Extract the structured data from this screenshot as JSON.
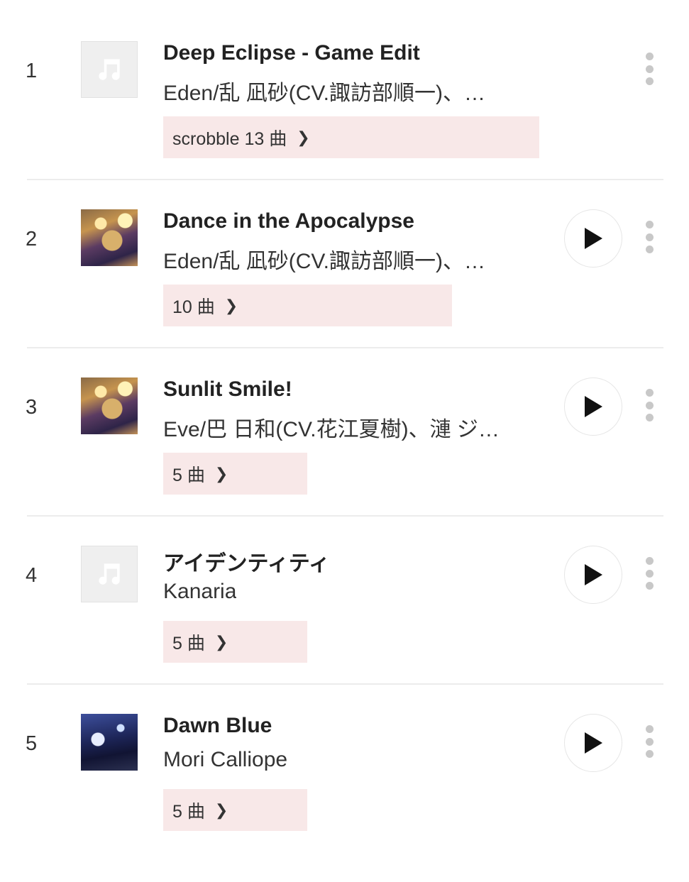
{
  "tracks": [
    {
      "rank": "1",
      "title": "Deep Eclipse - Game Edit",
      "artist": "Eden/乱 凪砂(CV.諏訪部順一)、…",
      "chip_label": "scrobble 13 曲",
      "artwork": "music-note-placeholder",
      "has_play": false
    },
    {
      "rank": "2",
      "title": "Dance in the Apocalypse",
      "artist": "Eden/乱 凪砂(CV.諏訪部順一)、…",
      "chip_label": "10 曲",
      "artwork": "album-art",
      "has_play": true
    },
    {
      "rank": "3",
      "title": "Sunlit Smile!",
      "artist": "Eve/巴 日和(CV.花江夏樹)、漣 ジ…",
      "chip_label": "5 曲",
      "artwork": "album-art",
      "has_play": true
    },
    {
      "rank": "4",
      "title": "アイデンティティ",
      "artist": "Kanaria",
      "chip_label": "5 曲",
      "artwork": "music-note-placeholder",
      "has_play": true
    },
    {
      "rank": "5",
      "title": "Dawn Blue",
      "artist": "Mori Calliope",
      "chip_label": "5 曲",
      "artwork": "album-art",
      "has_play": true
    }
  ],
  "icons": {
    "chevron": "chevron-right-icon",
    "play": "play-icon",
    "more": "more-vertical-icon",
    "placeholder": "music-note-icon"
  },
  "colors": {
    "chip_bg": "#f8e8e8",
    "divider": "#ececec",
    "text": "#222222",
    "icon_gray": "#c8c8c8"
  }
}
